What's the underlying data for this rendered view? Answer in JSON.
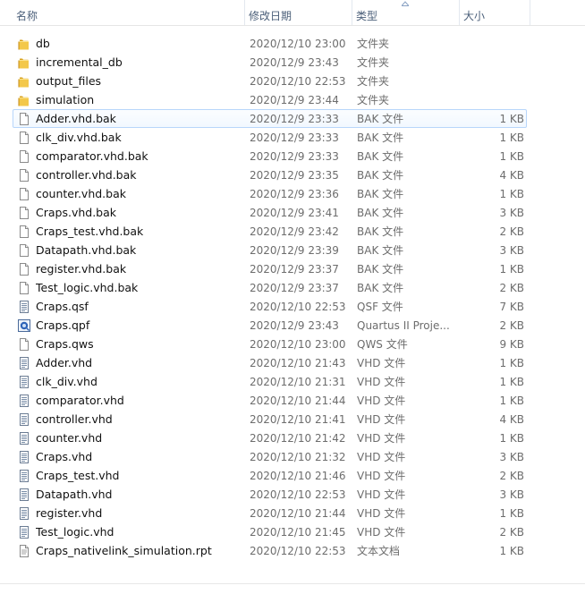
{
  "columns": {
    "name": "名称",
    "date": "修改日期",
    "type": "类型",
    "size": "大小"
  },
  "sort": {
    "column": "type",
    "direction": "ascending",
    "icon": "sort-up-icon"
  },
  "files": [
    {
      "name": "db",
      "date": "2020/12/10 23:00",
      "type": "文件夹",
      "size": "",
      "icon": "folder-icon"
    },
    {
      "name": "incremental_db",
      "date": "2020/12/9 23:43",
      "type": "文件夹",
      "size": "",
      "icon": "folder-icon"
    },
    {
      "name": "output_files",
      "date": "2020/12/10 22:53",
      "type": "文件夹",
      "size": "",
      "icon": "folder-icon"
    },
    {
      "name": "simulation",
      "date": "2020/12/9 23:44",
      "type": "文件夹",
      "size": "",
      "icon": "folder-icon"
    },
    {
      "name": "Adder.vhd.bak",
      "date": "2020/12/9 23:33",
      "type": "BAK 文件",
      "size": "1 KB",
      "icon": "file-icon",
      "hover": true
    },
    {
      "name": "clk_div.vhd.bak",
      "date": "2020/12/9 23:33",
      "type": "BAK 文件",
      "size": "1 KB",
      "icon": "file-icon"
    },
    {
      "name": "comparator.vhd.bak",
      "date": "2020/12/9 23:33",
      "type": "BAK 文件",
      "size": "1 KB",
      "icon": "file-icon"
    },
    {
      "name": "controller.vhd.bak",
      "date": "2020/12/9 23:35",
      "type": "BAK 文件",
      "size": "4 KB",
      "icon": "file-icon"
    },
    {
      "name": "counter.vhd.bak",
      "date": "2020/12/9 23:36",
      "type": "BAK 文件",
      "size": "1 KB",
      "icon": "file-icon"
    },
    {
      "name": "Craps.vhd.bak",
      "date": "2020/12/9 23:41",
      "type": "BAK 文件",
      "size": "3 KB",
      "icon": "file-icon"
    },
    {
      "name": "Craps_test.vhd.bak",
      "date": "2020/12/9 23:42",
      "type": "BAK 文件",
      "size": "2 KB",
      "icon": "file-icon"
    },
    {
      "name": "Datapath.vhd.bak",
      "date": "2020/12/9 23:39",
      "type": "BAK 文件",
      "size": "3 KB",
      "icon": "file-icon"
    },
    {
      "name": "register.vhd.bak",
      "date": "2020/12/9 23:37",
      "type": "BAK 文件",
      "size": "1 KB",
      "icon": "file-icon"
    },
    {
      "name": "Test_logic.vhd.bak",
      "date": "2020/12/9 23:37",
      "type": "BAK 文件",
      "size": "2 KB",
      "icon": "file-icon"
    },
    {
      "name": "Craps.qsf",
      "date": "2020/12/10 22:53",
      "type": "QSF 文件",
      "size": "7 KB",
      "icon": "text-file-icon"
    },
    {
      "name": "Craps.qpf",
      "date": "2020/12/9 23:43",
      "type": "Quartus II Proje...",
      "size": "2 KB",
      "icon": "quartus-project-icon"
    },
    {
      "name": "Craps.qws",
      "date": "2020/12/10 23:00",
      "type": "QWS 文件",
      "size": "9 KB",
      "icon": "file-icon"
    },
    {
      "name": "Adder.vhd",
      "date": "2020/12/10 21:43",
      "type": "VHD 文件",
      "size": "1 KB",
      "icon": "text-file-icon"
    },
    {
      "name": "clk_div.vhd",
      "date": "2020/12/10 21:31",
      "type": "VHD 文件",
      "size": "1 KB",
      "icon": "text-file-icon"
    },
    {
      "name": "comparator.vhd",
      "date": "2020/12/10 21:44",
      "type": "VHD 文件",
      "size": "1 KB",
      "icon": "text-file-icon"
    },
    {
      "name": "controller.vhd",
      "date": "2020/12/10 21:41",
      "type": "VHD 文件",
      "size": "4 KB",
      "icon": "text-file-icon"
    },
    {
      "name": "counter.vhd",
      "date": "2020/12/10 21:42",
      "type": "VHD 文件",
      "size": "1 KB",
      "icon": "text-file-icon"
    },
    {
      "name": "Craps.vhd",
      "date": "2020/12/10 21:32",
      "type": "VHD 文件",
      "size": "3 KB",
      "icon": "text-file-icon"
    },
    {
      "name": "Craps_test.vhd",
      "date": "2020/12/10 21:46",
      "type": "VHD 文件",
      "size": "2 KB",
      "icon": "text-file-icon"
    },
    {
      "name": "Datapath.vhd",
      "date": "2020/12/10 22:53",
      "type": "VHD 文件",
      "size": "3 KB",
      "icon": "text-file-icon"
    },
    {
      "name": "register.vhd",
      "date": "2020/12/10 21:44",
      "type": "VHD 文件",
      "size": "1 KB",
      "icon": "text-file-icon"
    },
    {
      "name": "Test_logic.vhd",
      "date": "2020/12/10 21:45",
      "type": "VHD 文件",
      "size": "2 KB",
      "icon": "text-file-icon"
    },
    {
      "name": "Craps_nativelink_simulation.rpt",
      "date": "2020/12/10 22:53",
      "type": "文本文档",
      "size": "1 KB",
      "icon": "text-document-icon"
    }
  ],
  "colors": {
    "header_text": "#4c607a",
    "hover_border": "#b8d6fb",
    "folder": "#e8b938",
    "secondary_text": "#6d6d6d"
  }
}
